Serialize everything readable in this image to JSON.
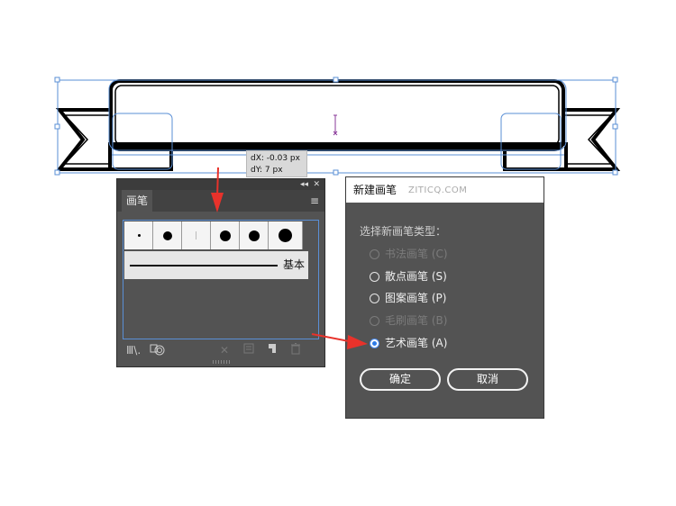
{
  "canvas": {
    "tooltip": {
      "dx": "dX: -0.03 px",
      "dy": "dY: 7 px"
    }
  },
  "brushes_panel": {
    "tab_label": "画笔",
    "collapse_glyph": "◂◂",
    "close_glyph": "✕",
    "menu_glyph": "≡",
    "brush_dot_sizes": [
      "tiny",
      "medium",
      "hair",
      "large",
      "large",
      "xlarge"
    ],
    "basic_brush_label": "基本",
    "footer_icons": [
      "brush-library-icon",
      "remove-brush-stroke-icon",
      "delete-icon",
      "options-icon",
      "new-brush-icon",
      "trash-icon"
    ]
  },
  "new_brush_dialog": {
    "title": "新建画笔",
    "watermark": "ZITICQ.COM",
    "prompt": "选择新画笔类型：",
    "options": [
      {
        "label": "书法画笔 (C)",
        "enabled": false,
        "selected": false
      },
      {
        "label": "散点画笔 (S)",
        "enabled": true,
        "selected": false
      },
      {
        "label": "图案画笔 (P)",
        "enabled": true,
        "selected": false
      },
      {
        "label": "毛刷画笔 (B)",
        "enabled": false,
        "selected": false
      },
      {
        "label": "艺术画笔 (A)",
        "enabled": true,
        "selected": true
      }
    ],
    "ok_label": "确定",
    "cancel_label": "取消"
  },
  "colors": {
    "selection_blue": "#5a8fd6",
    "arrow_red": "#e8322b",
    "panel_bg": "#535353",
    "radio_selected": "#2d7be8"
  }
}
